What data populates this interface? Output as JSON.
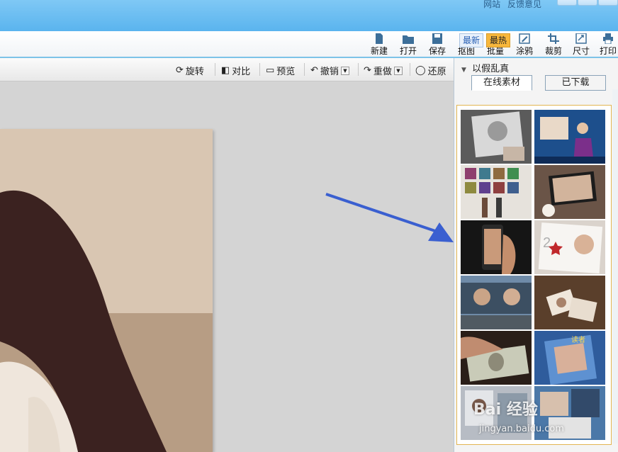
{
  "title_links": {
    "website": "网站",
    "feedback": "反馈意见"
  },
  "toolbar": {
    "items": [
      {
        "label": "新建",
        "icon": "new-file-icon"
      },
      {
        "label": "打开",
        "icon": "open-folder-icon"
      },
      {
        "label": "保存",
        "icon": "save-icon"
      },
      {
        "label": "抠图",
        "icon": "cutout-icon"
      },
      {
        "label": "批量",
        "icon": "batch-gear-icon"
      },
      {
        "label": "涂鸦",
        "icon": "doodle-icon"
      },
      {
        "label": "裁剪",
        "icon": "crop-icon"
      },
      {
        "label": "尺寸",
        "icon": "resize-icon"
      },
      {
        "label": "打印",
        "icon": "printer-icon"
      }
    ]
  },
  "edit_bar": {
    "rotate": "旋转",
    "compare": "对比",
    "preview": "预览",
    "undo": "撤销",
    "redo": "重做",
    "restore": "还原"
  },
  "side_panel": {
    "title": "以假乱真",
    "tabs": {
      "online": "在线素材",
      "downloaded": "已下载"
    },
    "subtabs": {
      "newest": "最新",
      "hottest": "最热"
    },
    "thumbnails": [
      {
        "name": "pencil-sketch-portrait"
      },
      {
        "name": "tv-news-anchor"
      },
      {
        "name": "gallery-wall-portraits"
      },
      {
        "name": "laptop-screen-portrait"
      },
      {
        "name": "phone-in-hand-portrait"
      },
      {
        "name": "magazine-portrait"
      },
      {
        "name": "billboard-couple"
      },
      {
        "name": "photo-prints-stack"
      },
      {
        "name": "banknote-portrait"
      },
      {
        "name": "magazine-cover-portrait"
      },
      {
        "name": "baidu-collage-portrait"
      },
      {
        "name": "photo-collage-portrait"
      }
    ]
  },
  "watermark": {
    "logo": "Bai 经验",
    "url": "jingyan.baidu.com"
  },
  "colors": {
    "titlebar": "#6dbdf1",
    "accent_arrow": "#3a5fd0",
    "hot_tab": "#f7b73c"
  }
}
